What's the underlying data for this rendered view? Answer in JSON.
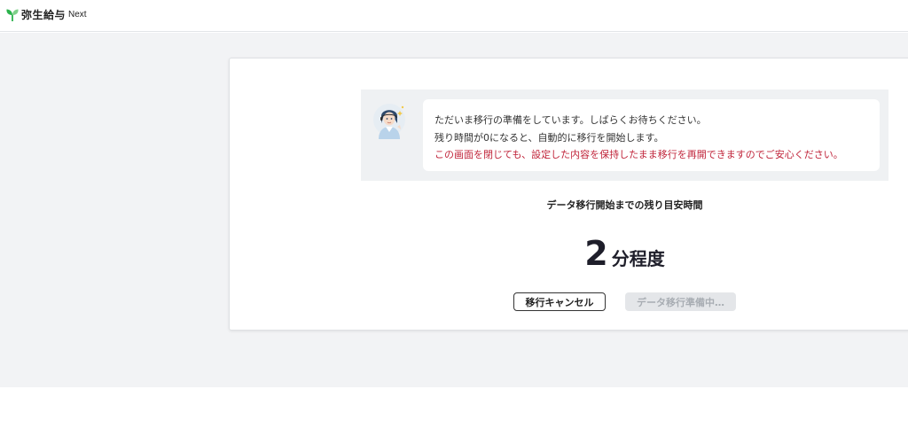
{
  "header": {
    "logo_jp": "弥生給与",
    "logo_en": "Next",
    "logo_icon": "sprout-icon"
  },
  "status_message": {
    "avatar_icon": "support-operator-avatar",
    "line1": "ただいま移行の準備をしています。しばらくお待ちください。",
    "line2": "残り時間が0になると、自動的に移行を開始します。",
    "line3": "この画面を閉じても、設定した内容を保持したまま移行を再開できますのでご安心ください。",
    "warning_color": "#c0243a"
  },
  "remaining": {
    "label": "データ移行開始までの残り目安時間",
    "value": "2",
    "unit": "分程度"
  },
  "actions": {
    "cancel_label": "移行キャンセル",
    "preparing_label": "データ移行準備中…"
  },
  "colors": {
    "brand_green": "#2bb24c",
    "background": "#f2f3f5",
    "panel": "#eff1f3"
  }
}
